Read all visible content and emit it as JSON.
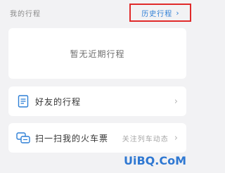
{
  "header": {
    "title": "我的行程",
    "history_label": "历史行程",
    "history_chevron": "›"
  },
  "empty_state": {
    "text": "暂无近期行程"
  },
  "rows": {
    "friends": {
      "icon": "document-icon",
      "label": "好友的行程",
      "chevron": "›"
    },
    "scan": {
      "icon": "ticket-scan-icon",
      "label": "扫一扫我的火车票",
      "sub": "关注列车动态",
      "chevron": "›"
    }
  },
  "watermark": {
    "text": "UiBQ.CoM"
  },
  "colors": {
    "accent_blue": "#2d7fd6",
    "highlight_red": "#e02a2a",
    "background": "#f2f2f4"
  }
}
